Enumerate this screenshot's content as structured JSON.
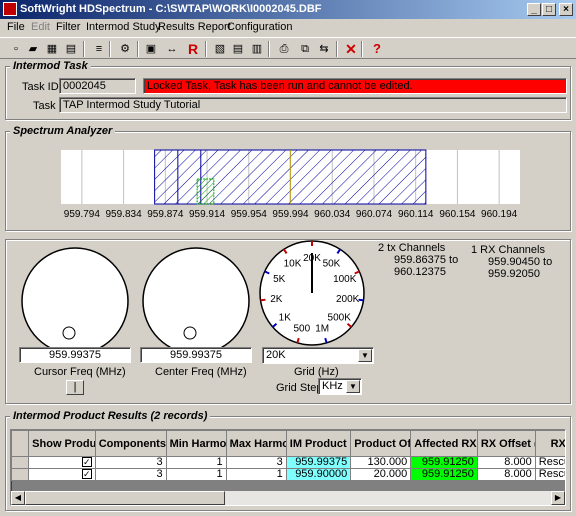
{
  "window": {
    "title": "SoftWright HDSpectrum - C:\\SWTAP\\WORK\\I0002045.DBF",
    "min": "_",
    "max": "□",
    "close": "×"
  },
  "menu": [
    "File",
    "Edit",
    "Filter",
    "Intermod Study",
    "Results Report",
    "Configuration"
  ],
  "toolbar": {
    "icons": [
      "new-file-icon",
      "open-folder-icon",
      "save-icon",
      "save-all-icon",
      "spectrum-view-icon",
      "print-setup-icon",
      "select-icon",
      "move-arrows-icon",
      "run-icon",
      "report-icon",
      "document-icon",
      "document-list-icon",
      "print-icon",
      "copy-icon",
      "export-icon",
      "delete-icon",
      "help-icon"
    ],
    "glyphs": [
      "▫",
      "▰",
      "▦",
      "▤",
      "≡",
      "⚙",
      "▣",
      "↔",
      "R",
      "▧",
      "▤",
      "▥",
      "⎙",
      "⧉",
      "⇆",
      "✕",
      "?"
    ],
    "colors": {
      "run": "#cc0000",
      "delete": "#cc0000",
      "help": "#cc0000"
    }
  },
  "intermod_task": {
    "title": "Intermod Task",
    "task_id_label": "Task ID:",
    "task_id": "0002045",
    "locked_message": "Locked Task, Task has been run and cannot be edited.",
    "locked_color": "#ff0000",
    "task_label": "Task",
    "task_name": "TAP Intermod Study Tutorial"
  },
  "spectrum": {
    "title": "Spectrum Analyzer",
    "freq_labels": [
      "959.794",
      "959.834",
      "959.874",
      "959.914",
      "959.954",
      "959.994",
      "960.034",
      "960.074",
      "960.114",
      "960.154",
      "960.194"
    ],
    "freq_min": 959.774,
    "freq_max": 960.214,
    "tx_band": [
      959.86375,
      960.12375
    ],
    "rx_band": [
      959.9045,
      959.9205
    ],
    "cursor_freq": 959.99375,
    "colors": {
      "tx": "#0000a0",
      "rx": "#00a000",
      "cursor": "#c0a000"
    }
  },
  "controls": {
    "cursor_freq_value": "959.99375",
    "cursor_freq_label": "Cursor Freq (MHz)",
    "center_freq_value": "959.99375",
    "center_freq_label": "Center Freq (MHz)",
    "cursor_small_button": "|",
    "grid_labels": [
      "20K",
      "50K",
      "100K",
      "200K",
      "500K",
      "1M",
      "500",
      "1K",
      "2K",
      "5K",
      "10K"
    ],
    "grid_value": "20K",
    "grid_label": "Grid (Hz)",
    "grid_step_label": "Grid Step",
    "grid_step_value": "KHz",
    "tx_channels_heading": "2 tx Channels",
    "tx_channels_range": "959.86375 to\n960.12375",
    "rx_channels_heading": "1 RX Channels",
    "rx_channels_range": "959.90450 to\n959.92050"
  },
  "results": {
    "title": "Intermod Product Results (2 records)",
    "columns": [
      "Show Product?",
      "Components",
      "Min Harmonic",
      "Max Harmonic",
      "IM Product (MHz)",
      "Product Offset",
      "Affected RX (MHz)",
      "RX Offset (KHz)",
      "RX Desc"
    ],
    "rows": [
      {
        "show": true,
        "components": "3",
        "min_harmonic": "1",
        "max_harmonic": "3",
        "im_product": "959.99375",
        "product_offset": "130.000",
        "affected_rx": "959.91250",
        "rx_offset": "8.000",
        "rx_desc": "Rescue"
      },
      {
        "show": true,
        "components": "3",
        "min_harmonic": "1",
        "max_harmonic": "1",
        "im_product": "959.90000",
        "product_offset": "20.000",
        "affected_rx": "959.91250",
        "rx_offset": "8.000",
        "rx_desc": "Rescue"
      }
    ],
    "im_product_color": "#80ffff",
    "affected_rx_color": "#00ff00"
  }
}
